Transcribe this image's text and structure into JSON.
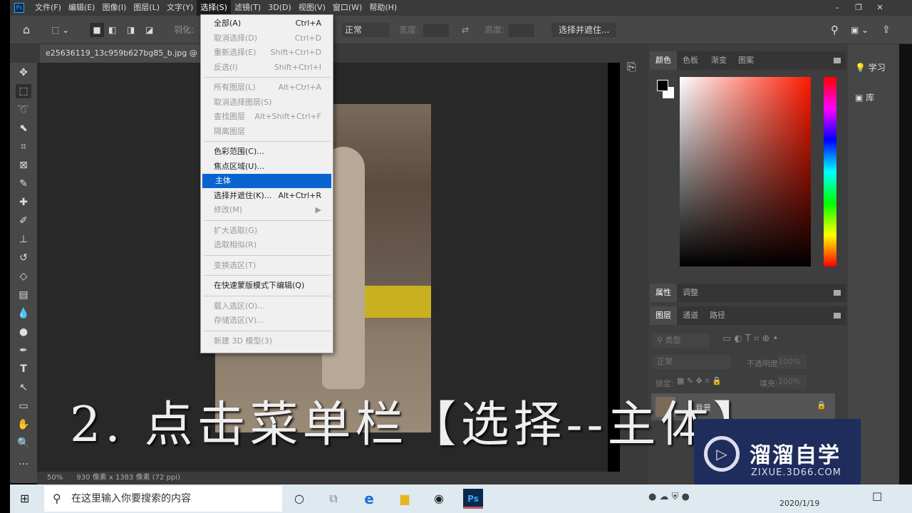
{
  "menubar": {
    "items": [
      "文件(F)",
      "编辑(E)",
      "图像(I)",
      "图层(L)",
      "文字(Y)",
      "选择(S)",
      "滤镜(T)",
      "3D(D)",
      "视图(V)",
      "窗口(W)",
      "帮助(H)"
    ],
    "active": "选择(S)",
    "ps_logo": "Ps"
  },
  "options": {
    "feather_label": "羽化:",
    "style_value": "正常",
    "width_label": "宽度:",
    "height_label": "高度:",
    "select_mask_button": "选择并遮住..."
  },
  "document": {
    "tab_title": "e25636119_13c959b627bg85_b.jpg @ 50%",
    "zoom": "50%",
    "size_info": "930 像素 x 1383 像素 (72 ppi)"
  },
  "select_menu": {
    "items": [
      {
        "label": "全部(A)",
        "shortcut": "Ctrl+A",
        "enabled": true
      },
      {
        "label": "取消选择(D)",
        "shortcut": "Ctrl+D",
        "enabled": false
      },
      {
        "label": "重新选择(E)",
        "shortcut": "Shift+Ctrl+D",
        "enabled": false
      },
      {
        "label": "反选(I)",
        "shortcut": "Shift+Ctrl+I",
        "enabled": false
      },
      {
        "label": "所有图层(L)",
        "shortcut": "Alt+Ctrl+A",
        "enabled": false
      },
      {
        "label": "取消选择图层(S)",
        "shortcut": "",
        "enabled": false
      },
      {
        "label": "查找图层",
        "shortcut": "Alt+Shift+Ctrl+F",
        "enabled": false
      },
      {
        "label": "隔离图层",
        "shortcut": "",
        "enabled": false
      },
      {
        "label": "色彩范围(C)...",
        "shortcut": "",
        "enabled": true
      },
      {
        "label": "焦点区域(U)...",
        "shortcut": "",
        "enabled": true
      },
      {
        "label": "主体",
        "shortcut": "",
        "enabled": true,
        "highlighted": true
      },
      {
        "label": "选择并遮住(K)...",
        "shortcut": "Alt+Ctrl+R",
        "enabled": true
      },
      {
        "label": "修改(M)",
        "shortcut": "▶",
        "enabled": false
      },
      {
        "label": "扩大选取(G)",
        "shortcut": "",
        "enabled": false
      },
      {
        "label": "选取相似(R)",
        "shortcut": "",
        "enabled": false
      },
      {
        "label": "变换选区(T)",
        "shortcut": "",
        "enabled": false
      },
      {
        "label": "在快速蒙版模式下编辑(Q)",
        "shortcut": "",
        "enabled": true
      },
      {
        "label": "载入选区(O)...",
        "shortcut": "",
        "enabled": false
      },
      {
        "label": "存储选区(V)...",
        "shortcut": "",
        "enabled": false
      },
      {
        "label": "新建 3D 模型(3)",
        "shortcut": "",
        "enabled": false
      }
    ]
  },
  "panels": {
    "color_tabs": [
      "颜色",
      "色板",
      "渐变",
      "图案"
    ],
    "props_tabs": [
      "属性",
      "调整"
    ],
    "layers_tabs": [
      "图层",
      "通道",
      "路径"
    ],
    "filter_placeholder": "类型",
    "blend_mode": "正常",
    "opacity_label": "不透明度:",
    "opacity": "100%",
    "lock_label": "锁定:",
    "fill_label": "填充:",
    "fill": "100%",
    "layer_name": "背景"
  },
  "learn": {
    "learn": "学习",
    "library": "库"
  },
  "subtitle": "2. 点击菜单栏【选择--主体】",
  "watermark": {
    "brand": "溜溜自学",
    "url": "ZIXUE.3D66.COM"
  },
  "taskbar": {
    "search_placeholder": "在这里输入你要搜索的内容",
    "date": "2020/1/19",
    "ps": "Ps"
  },
  "colors": {
    "highlight": "#0a64d0",
    "watermark_bg": "#1f2d5c"
  }
}
